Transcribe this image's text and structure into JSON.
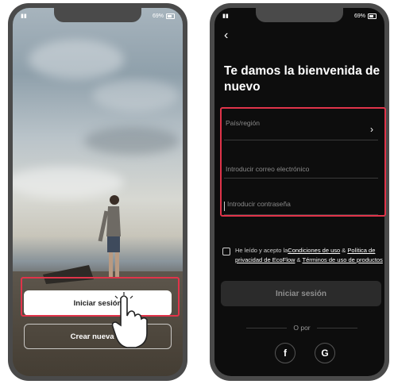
{
  "left_phone": {
    "status_right": "69%",
    "login_button": "Iniciar sesión",
    "create_account_button": "Crear nueva cu"
  },
  "right_phone": {
    "status_right": "69%",
    "back_icon": "chevron-left-icon",
    "title": "Te damos la bienvenida de nuevo",
    "country_placeholder": "País/región",
    "email_placeholder": "Introducir correo electrónico",
    "password_placeholder": "Introducir contraseña",
    "terms_prefix": "He leído y acepto la",
    "terms_link1": "Condiciones de uso",
    "terms_amp1": " & ",
    "terms_link2": "Política de privacidad de EcoFlow",
    "terms_amp2": " & ",
    "terms_link3": "Términos de uso de productos",
    "signin_button": "Iniciar sesión",
    "or_text": "O por",
    "facebook_label": "f",
    "google_label": "G"
  },
  "colors": {
    "highlight": "#e0344a",
    "dark_bg": "#0d0d0d",
    "primary_button": "#ffffff"
  }
}
